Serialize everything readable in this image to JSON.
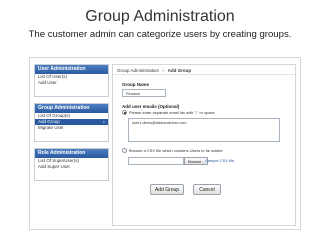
{
  "slide": {
    "title": "Group Administration",
    "subtitle": "The customer admin can categorize users by creating groups."
  },
  "sidebar": {
    "user_admin": {
      "header": "User Administration",
      "items": [
        "List Of User(s)",
        "Add User"
      ]
    },
    "group_admin": {
      "header": "Group Administration",
      "items": [
        "List Of Group(s)",
        "Add Group",
        "Migrate User"
      ],
      "active_index": 1,
      "active_arrow": "»"
    },
    "role_admin": {
      "header": "Role Administration",
      "items": [
        "List Of SuperUser(s)",
        "Add Super User"
      ]
    }
  },
  "breadcrumb": {
    "root": "Group Administration",
    "separator": ">",
    "current": "Add Group"
  },
  "form": {
    "group_name_label": "Group Name",
    "group_name_value": "Finance",
    "user_emails_label": "Add user emails (Optional)",
    "radio_enter_label": "Please enter separate email ids with \";\" or space",
    "emails_value": "user1.demo@dddomainxxx.com",
    "radio_csv_label": "Browse a CSV file which contains Users to be added",
    "browse_label": "Browse..",
    "sample_csv_label": "Sample CSV file",
    "add_group_label": "Add Group",
    "cancel_label": "Cancel"
  }
}
